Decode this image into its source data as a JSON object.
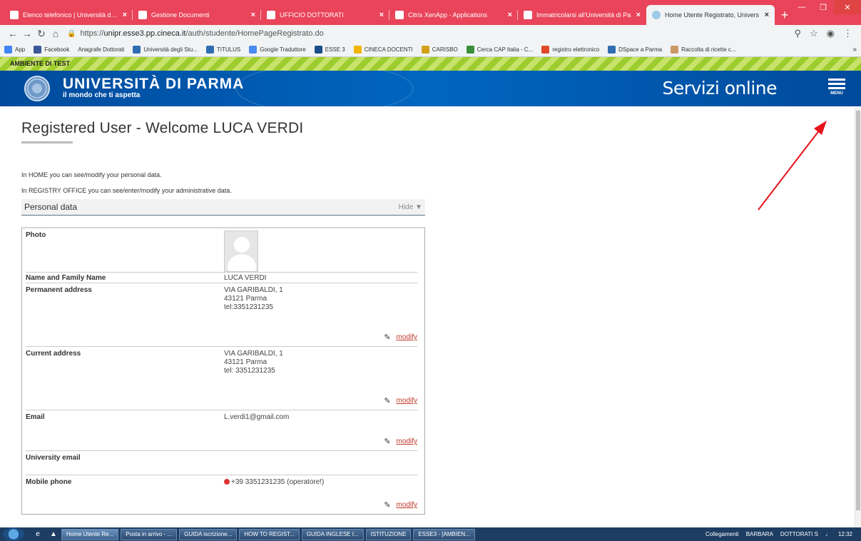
{
  "browser": {
    "tabs": [
      {
        "title": "Elenco telefonico | Università degl",
        "active": false
      },
      {
        "title": "Gestione Documenti",
        "active": false
      },
      {
        "title": "UFFICIO DOTTORATI",
        "active": false
      },
      {
        "title": "Citrix XenApp - Applications",
        "active": false
      },
      {
        "title": "Immatricolarsi all'Università di Pa",
        "active": false
      },
      {
        "title": "Home Utente Registrato, Univers",
        "active": true
      }
    ],
    "new_tab": "+",
    "url_scheme": "https://",
    "url_host": "unipr.esse3.pp.cineca.it",
    "url_path": "/auth/studente/HomePageRegistrato.do",
    "bookmarks": [
      {
        "label": "App",
        "icon": "apps-icon",
        "color": "#4285f4"
      },
      {
        "label": "Facebook",
        "icon": "facebook-icon",
        "color": "#3b5998"
      },
      {
        "label": "Anagrafe Dottorati",
        "icon": "",
        "color": ""
      },
      {
        "label": "Università degli Stu...",
        "icon": "unipr-icon",
        "color": "#2f6db2"
      },
      {
        "label": "TITULUS",
        "icon": "unipr-icon",
        "color": "#2f6db2"
      },
      {
        "label": "Google Traduttore",
        "icon": "translate-icon",
        "color": "#4a8af4"
      },
      {
        "label": "ESSE 3",
        "icon": "esse3-icon",
        "color": "#1a4f8b"
      },
      {
        "label": "CINECA DOCENTI",
        "icon": "cineca-icon",
        "color": "#f0b400"
      },
      {
        "label": "CARISBO",
        "icon": "carisbo-icon",
        "color": "#d4a017"
      },
      {
        "label": "Cerca CAP Italia - C...",
        "icon": "cap-icon",
        "color": "#3a8f3a"
      },
      {
        "label": "registro elettronico",
        "icon": "registro-icon",
        "color": "#e04a2a"
      },
      {
        "label": "DSpace a Parma",
        "icon": "dspace-icon",
        "color": "#2f6db2"
      },
      {
        "label": "Raccolta di ricette c...",
        "icon": "recipe-icon",
        "color": "#c96"
      }
    ],
    "bookmarks_more": "»"
  },
  "test_banner": "AMBIENTE DI TEST",
  "header": {
    "university": "UNIVERSITÀ DI PARMA",
    "tagline": "il mondo che ti aspetta",
    "servizi": "Servizi online",
    "menu_label": "MENU"
  },
  "page": {
    "title": "Registered User - Welcome LUCA VERDI",
    "intro_home": "In HOME you can see/modify your personal data.",
    "intro_registry": "In REGISTRY OFFICE you can see/enter/modify your administrative data.",
    "section_title": "Personal data",
    "section_toggle": "Hide",
    "modify_label": "modify",
    "photo_label": "Photo",
    "name_label": "Name and Family Name",
    "name_value": "LUCA VERDI",
    "permanent_label": "Permanent address",
    "permanent_lines": [
      "VIA GARIBALDI, 1",
      "43121 Parma",
      "tel:3351231235"
    ],
    "current_label": "Current address",
    "current_lines": [
      "VIA GARIBALDI, 1",
      "43121 Parma",
      "tel: 3351231235"
    ],
    "email_label": "Email",
    "email_value": "L.verdi1@gmail.com",
    "uni_email_label": "University email",
    "mobile_label": "Mobile phone",
    "mobile_value": "+39 3351231235 (operatore!)"
  },
  "taskbar": {
    "items": [
      {
        "label": "Home Utente Re...",
        "active": true
      },
      {
        "label": "Posta in arrivo - ...",
        "active": false
      },
      {
        "label": "GUIDA iscrizione...",
        "active": false
      },
      {
        "label": "HOW TO REGIST...",
        "active": false
      },
      {
        "label": "GUIDA INGLESE I...",
        "active": false
      },
      {
        "label": "ISTITUZIONE",
        "active": false
      },
      {
        "label": "ESSE3 - [AMBIEN...",
        "active": false
      }
    ],
    "links": "Collegamenti",
    "user1": "BARBARA",
    "user2": "DOTTORATI S",
    "clock": "12:32"
  },
  "annotation_color": "#e8121b"
}
